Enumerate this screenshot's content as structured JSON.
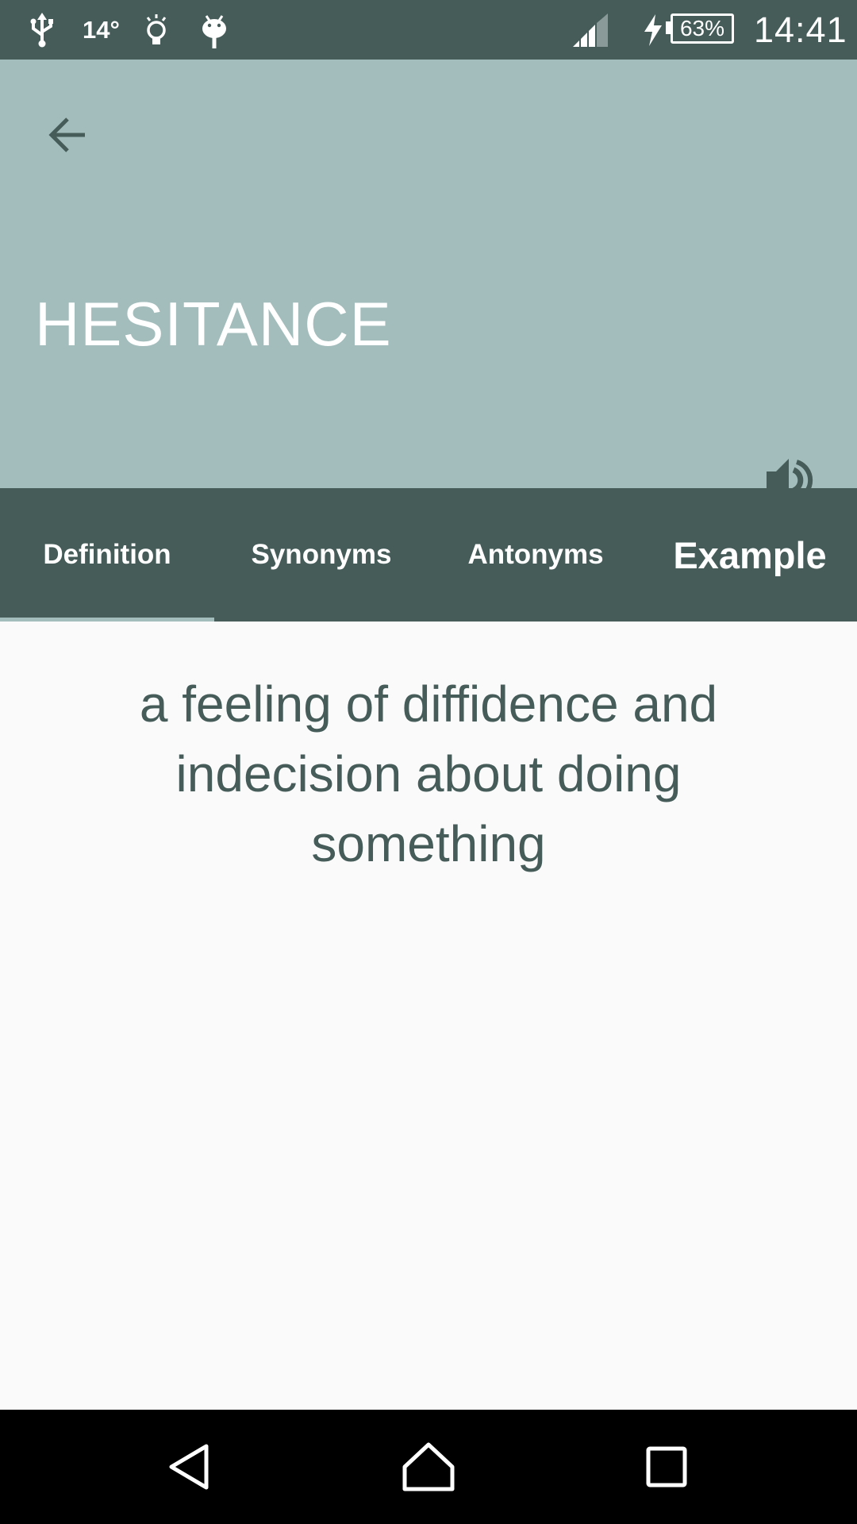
{
  "status_bar": {
    "temperature": "14°",
    "battery": "63%",
    "clock": "14:41",
    "icons": [
      "usb-icon",
      "lightbulb-icon",
      "android-debug-icon",
      "signal-icon",
      "charging-icon",
      "battery-icon"
    ]
  },
  "header": {
    "word": "HESITANCE",
    "back_icon": "arrow-left-icon",
    "speaker_icon": "volume-up-icon",
    "background_color": "#a3bdbc"
  },
  "tabs": [
    {
      "label": "Definition",
      "selected": true
    },
    {
      "label": "Synonyms",
      "selected": false
    },
    {
      "label": "Antonyms",
      "selected": false
    },
    {
      "label": "Example",
      "selected": false
    }
  ],
  "content": {
    "definition": "a feeling of diffidence and indecision about doing something"
  },
  "nav_bar": {
    "icons": [
      "nav-back-icon",
      "nav-home-icon",
      "nav-recents-icon"
    ]
  },
  "colors": {
    "primary_dark": "#455c59",
    "primary_light": "#a3bdbc",
    "text_on_dark": "#ffffff",
    "content_bg": "#fafafa"
  }
}
